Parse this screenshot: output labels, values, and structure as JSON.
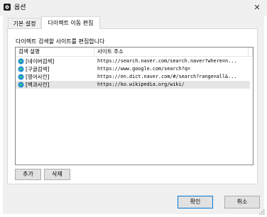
{
  "window": {
    "title": "옵션",
    "close_glyph": "✕"
  },
  "tabs": [
    {
      "label": "기본 설정"
    },
    {
      "label": "다이렉트 이동 편집"
    }
  ],
  "panel": {
    "description": "다이렉트 검색할 사이트를 편집합니다"
  },
  "list": {
    "columns": [
      "검색 설명",
      "사이트 주소",
      ""
    ],
    "rows": [
      {
        "icon": "edge-icon",
        "name": "[네이버검색]",
        "url": "https://search.naver.com/search.naver?where=n..."
      },
      {
        "icon": "edge-icon",
        "name": "[구글검색]",
        "url": "https://www.google.com/search?q="
      },
      {
        "icon": "edge-icon",
        "name": "[영어사전]",
        "url": "https://en.dict.naver.com/#/search?range=all&..."
      },
      {
        "icon": "edge-icon",
        "name": "[백과사전]",
        "url": "https://ko.wikipedia.org/wiki/",
        "selected": true
      }
    ]
  },
  "buttons": {
    "add": "추가",
    "delete": "삭제",
    "ok": "확인",
    "cancel": "취소"
  },
  "colors": {
    "accent": "#0078d7",
    "selection": "#e5e5e5",
    "dialog_bg": "#f0f0f0"
  }
}
